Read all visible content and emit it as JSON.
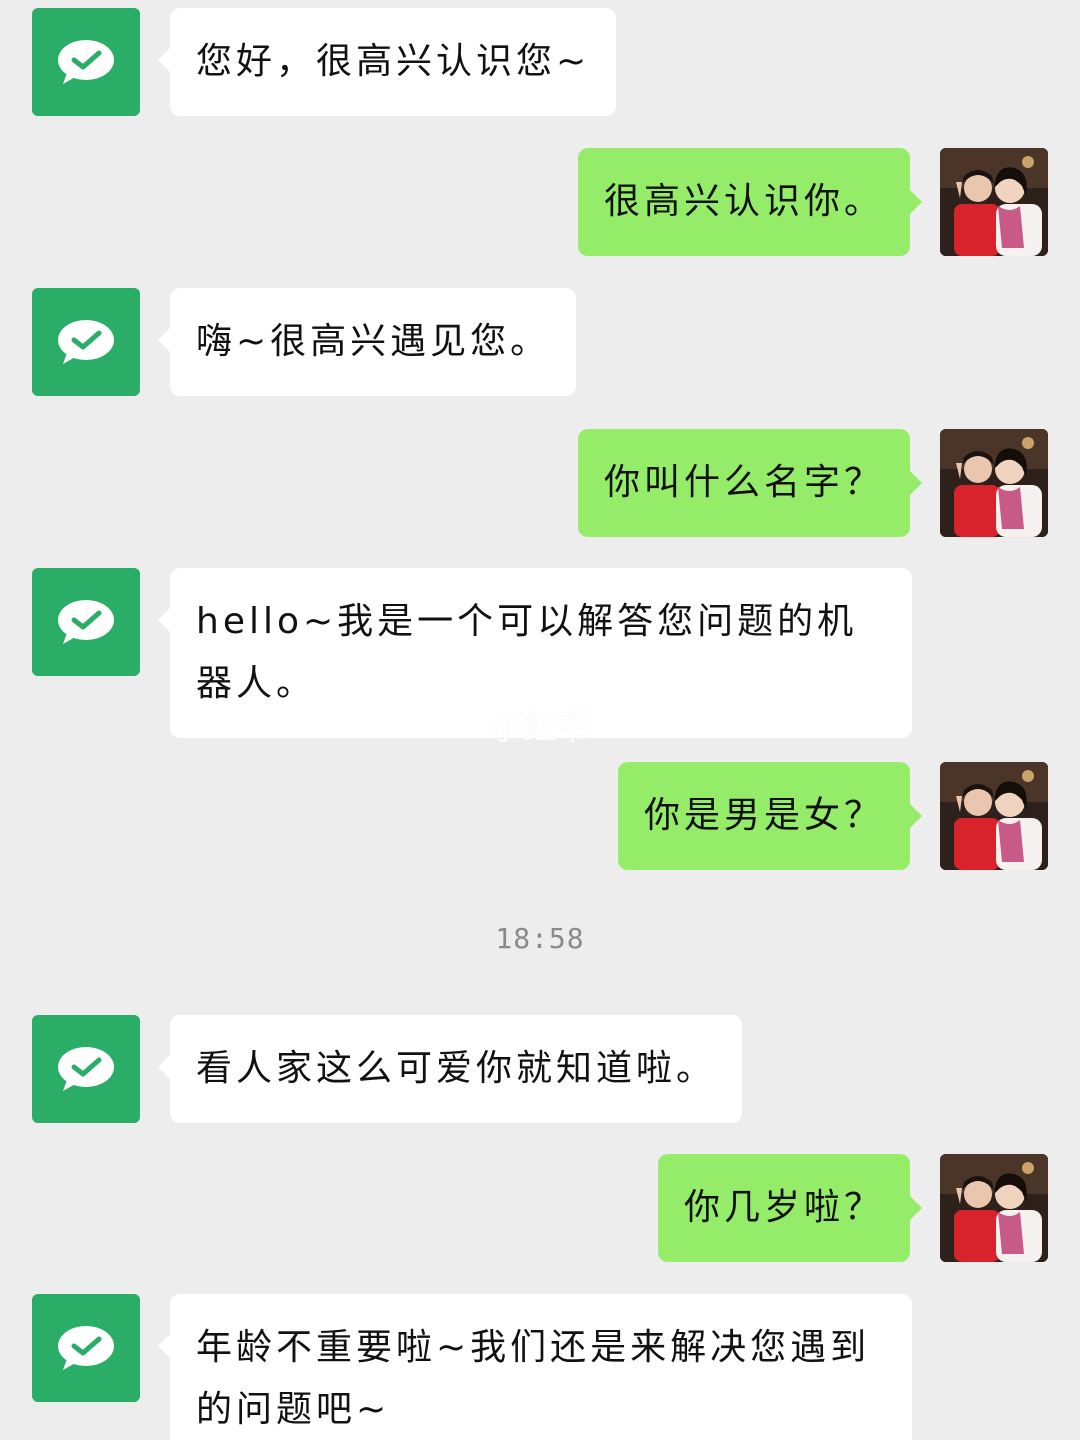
{
  "chat": {
    "timestamp": "18:58",
    "watermark": "小红书",
    "bot_avatar_icon": "wechat-chat-bubble-icon",
    "colors": {
      "background": "#ededed",
      "bot_bubble": "#ffffff",
      "user_bubble": "#95ec69",
      "bot_avatar": "#2aae67"
    },
    "messages": [
      {
        "sender": "bot",
        "text": "您好，很高兴认识您~"
      },
      {
        "sender": "user",
        "text": "很高兴认识你。"
      },
      {
        "sender": "bot",
        "text": "嗨~很高兴遇见您。"
      },
      {
        "sender": "user",
        "text": "你叫什么名字？"
      },
      {
        "sender": "bot",
        "text": "hello~我是一个可以解答您问题的机器人。"
      },
      {
        "sender": "user",
        "text": "你是男是女？"
      },
      {
        "sender": "bot",
        "text": "看人家这么可爱你就知道啦。"
      },
      {
        "sender": "user",
        "text": "你几岁啦？"
      },
      {
        "sender": "bot",
        "text": "年龄不重要啦~我们还是来解决您遇到的问题吧~"
      }
    ]
  }
}
